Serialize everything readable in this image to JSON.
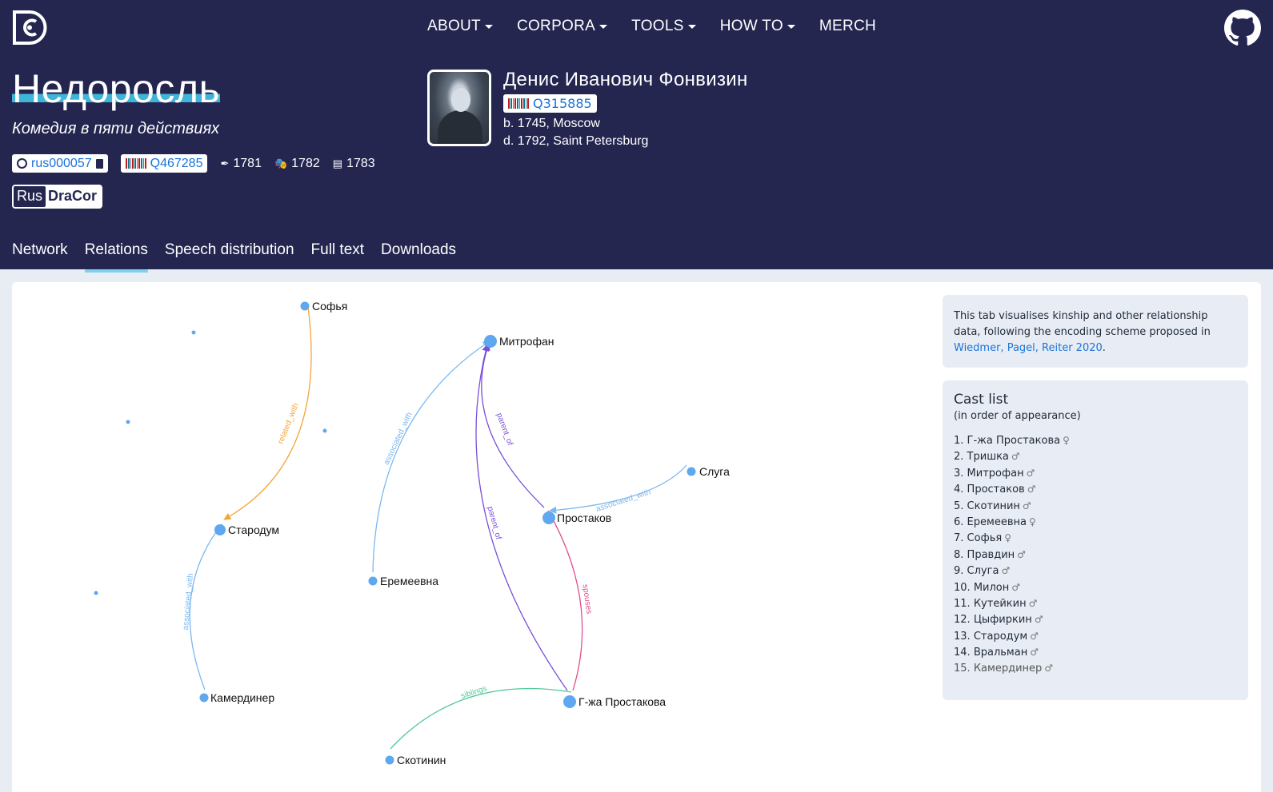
{
  "nav": {
    "logo": "dracor-logo",
    "items": [
      {
        "label": "ABOUT",
        "dropdown": true
      },
      {
        "label": "CORPORA",
        "dropdown": true
      },
      {
        "label": "TOOLS",
        "dropdown": true
      },
      {
        "label": "HOW TO",
        "dropdown": true
      },
      {
        "label": "MERCH",
        "dropdown": false
      }
    ],
    "github_icon": "github-icon"
  },
  "play": {
    "title": "Недоросль",
    "subtitle": "Комедия в пяти действиях",
    "dracor_id": "rus000057",
    "wikidata_id": "Q467285",
    "written": "1781",
    "premiered": "1782",
    "printed": "1783",
    "corpus": {
      "part1": "Rus",
      "part2": "DraCor"
    }
  },
  "author": {
    "name": "Денис Иванович Фонвизин",
    "wikidata_id": "Q315885",
    "born": "b. 1745, Moscow",
    "died": "d. 1792, Saint Petersburg"
  },
  "tabs": [
    {
      "label": "Network",
      "active": false
    },
    {
      "label": "Relations",
      "active": true
    },
    {
      "label": "Speech distribution",
      "active": false
    },
    {
      "label": "Full text",
      "active": false
    },
    {
      "label": "Downloads",
      "active": false
    }
  ],
  "info": {
    "text": "This tab visualises kinship and other relationship data, following the encoding scheme proposed in ",
    "link": "Wiedmer, Pagel, Reiter 2020",
    "end": "."
  },
  "cast": {
    "title": "Cast list",
    "subtitle": "(in order of appearance)",
    "items": [
      {
        "n": "1.",
        "name": "Г-жа Простакова",
        "gender": "♀"
      },
      {
        "n": "2.",
        "name": "Тришка",
        "gender": "♂"
      },
      {
        "n": "3.",
        "name": "Митрофан",
        "gender": "♂"
      },
      {
        "n": "4.",
        "name": "Простаков",
        "gender": "♂"
      },
      {
        "n": "5.",
        "name": "Скотинин",
        "gender": "♂"
      },
      {
        "n": "6.",
        "name": "Еремеевна",
        "gender": "♀"
      },
      {
        "n": "7.",
        "name": "Софья",
        "gender": "♀"
      },
      {
        "n": "8.",
        "name": "Правдин",
        "gender": "♂"
      },
      {
        "n": "9.",
        "name": "Слуга",
        "gender": "♂"
      },
      {
        "n": "10.",
        "name": "Милон",
        "gender": "♂"
      },
      {
        "n": "11.",
        "name": "Кутейкин",
        "gender": "♂"
      },
      {
        "n": "12.",
        "name": "Цыфиркин",
        "gender": "♂"
      },
      {
        "n": "13.",
        "name": "Стародум",
        "gender": "♂"
      },
      {
        "n": "14.",
        "name": "Вральман",
        "gender": "♂"
      },
      {
        "n": "15.",
        "name": "Камердинер",
        "gender": "♂"
      }
    ]
  },
  "graph": {
    "colors": {
      "node": "#5fa8f0",
      "associated_with": "#7ab8f0",
      "parent_of": "#7a4fd8",
      "related_with": "#f5a53a",
      "spouses": "#e0508f",
      "siblings": "#55c999"
    },
    "nodes": [
      {
        "label": "Софья"
      },
      {
        "label": "Митрофан"
      },
      {
        "label": "Слуга"
      },
      {
        "label": "Простаков"
      },
      {
        "label": "Стародум"
      },
      {
        "label": "Еремеевна"
      },
      {
        "label": "Камердинер"
      },
      {
        "label": "Г-жа Простакова"
      },
      {
        "label": "Скотинин"
      }
    ],
    "edges": [
      {
        "label": "related_with"
      },
      {
        "label": "associated_with"
      },
      {
        "label": "parent_of"
      },
      {
        "label": "parent_of"
      },
      {
        "label": "associated_with"
      },
      {
        "label": "spouses"
      },
      {
        "label": "associated_with"
      },
      {
        "label": "siblings"
      }
    ]
  }
}
